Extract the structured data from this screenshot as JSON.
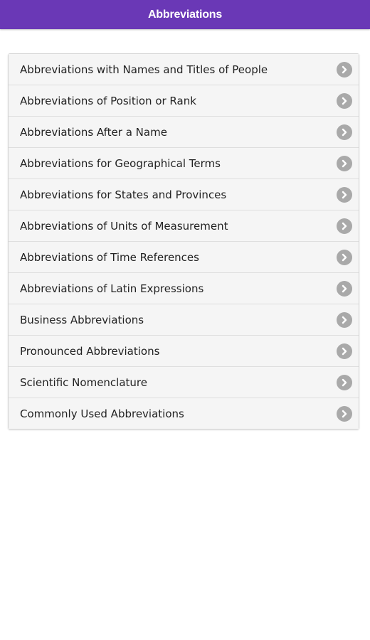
{
  "header": {
    "title": "Abbreviations",
    "color": "#6a38b6"
  },
  "menu": {
    "items": [
      {
        "label": "Abbreviations with Names and Titles of People",
        "icon": "chevron-right-circle-icon"
      },
      {
        "label": "Abbreviations of Position or Rank",
        "icon": "chevron-right-circle-icon"
      },
      {
        "label": "Abbreviations After a Name",
        "icon": "chevron-right-circle-icon"
      },
      {
        "label": "Abbreviations for Geographical Terms",
        "icon": "chevron-right-circle-icon"
      },
      {
        "label": "Abbreviations for States and Provinces",
        "icon": "chevron-right-circle-icon"
      },
      {
        "label": "Abbreviations of Units of Measurement",
        "icon": "chevron-right-circle-icon"
      },
      {
        "label": "Abbreviations of Time References",
        "icon": "chevron-right-circle-icon"
      },
      {
        "label": "Abbreviations of Latin Expressions",
        "icon": "chevron-right-circle-icon"
      },
      {
        "label": "Business Abbreviations",
        "icon": "chevron-right-circle-icon"
      },
      {
        "label": "Pronounced Abbreviations",
        "icon": "chevron-right-circle-icon"
      },
      {
        "label": "Scientific Nomenclature",
        "icon": "chevron-right-circle-icon"
      },
      {
        "label": "Commonly Used Abbreviations",
        "icon": "chevron-right-circle-icon"
      }
    ]
  }
}
